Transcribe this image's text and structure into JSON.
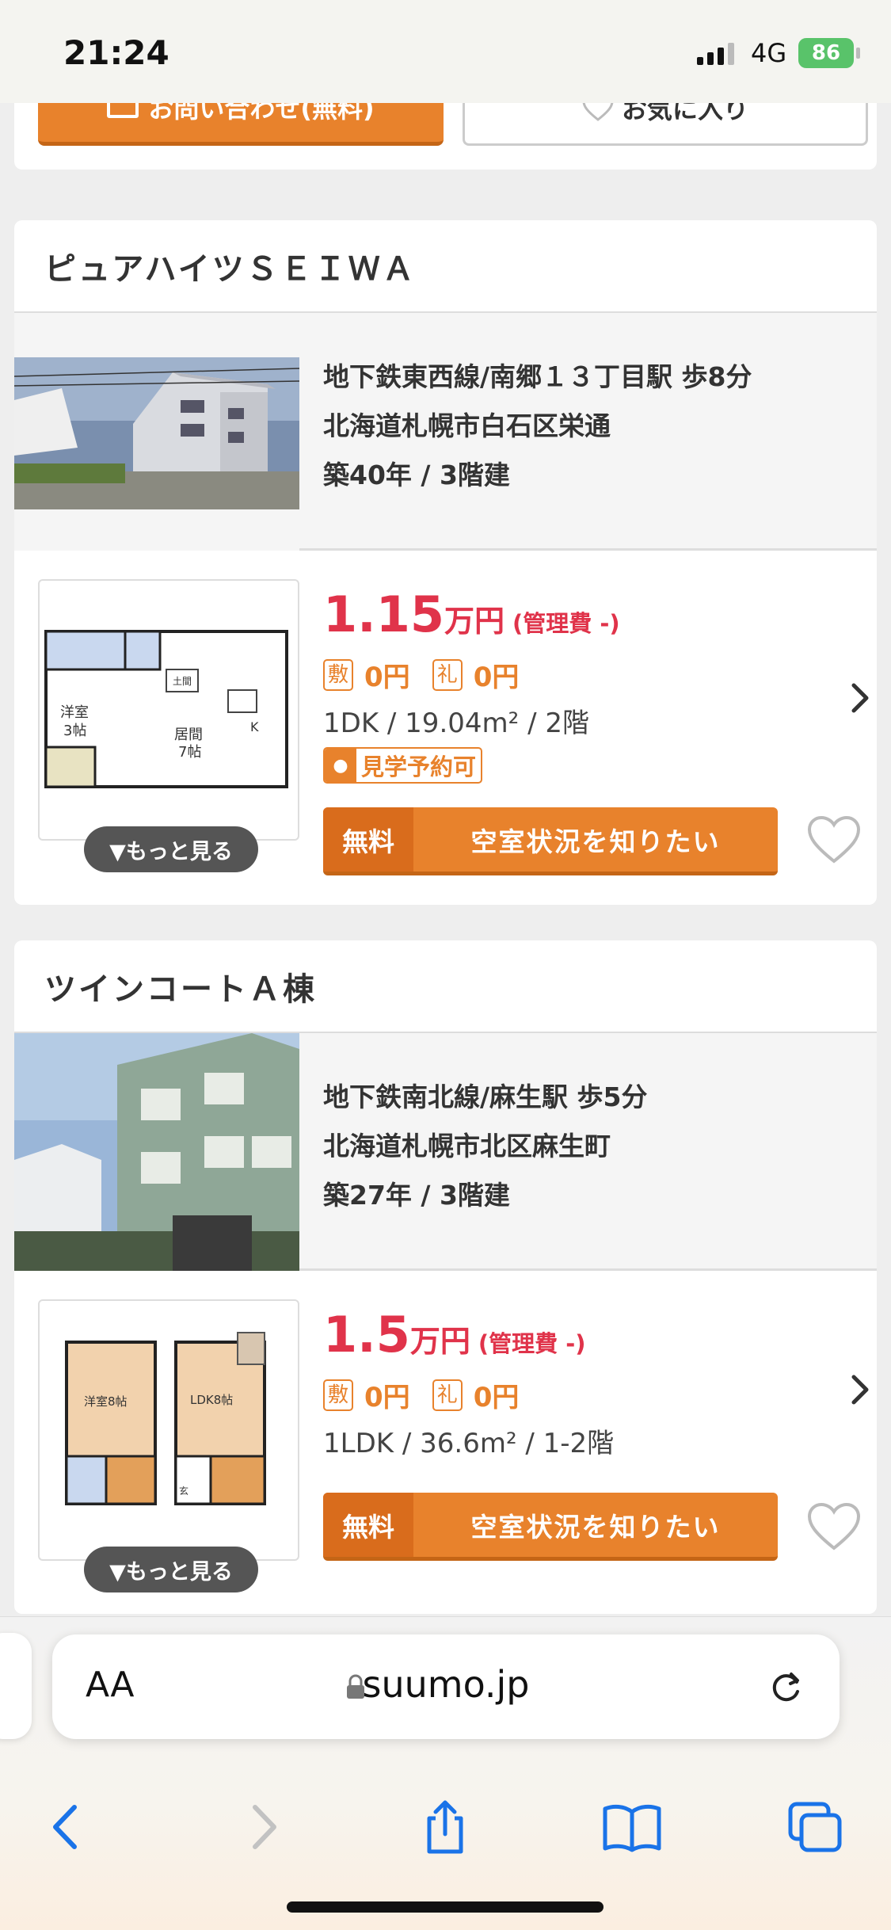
{
  "status_bar": {
    "time": "21:24",
    "network": "4G",
    "battery": "86"
  },
  "top_card": {
    "inquiry_label": "お問い合わせ(無料)",
    "favorite_label": "お気に入り"
  },
  "listings": [
    {
      "name": "ピュアハイツＳＥＩＷＡ",
      "access": "地下鉄東西線/南郷１３丁目駅 歩8分",
      "address": "北海道札幌市白石区栄通",
      "age": "築40年 / 3階建",
      "rent_value": "1.15",
      "rent_unit": "万円",
      "management_fee": "(管理費 -)",
      "deposit_tag": "敷",
      "deposit": "0円",
      "key_money_tag": "礼",
      "key_money": "0円",
      "spec": "1DK /  19.04m² /  2階",
      "visit_badge": "見学予約可",
      "more_label": "▼もっと見る",
      "vacancy_free": "無料",
      "vacancy_label": "空室状況を知りたい",
      "floorplan_labels": {
        "room1": "洋室",
        "room1_size": "3帖",
        "room2": "居間",
        "room2_size": "7帖",
        "k": "K",
        "entry": "土間"
      }
    },
    {
      "name": "ツインコートＡ棟",
      "access": "地下鉄南北線/麻生駅 歩5分",
      "address": "北海道札幌市北区麻生町",
      "age": "築27年 / 3階建",
      "rent_value": "1.5",
      "rent_unit": "万円",
      "management_fee": "(管理費 -)",
      "deposit_tag": "敷",
      "deposit": "0円",
      "key_money_tag": "礼",
      "key_money": "0円",
      "spec": "1LDK /  36.6m² /  1-2階",
      "more_label": "▼もっと見る",
      "vacancy_free": "無料",
      "vacancy_label": "空室状況を知りたい",
      "floorplan_labels": {
        "room1": "洋室8帖",
        "room2": "LDK8帖",
        "entry": "玄"
      }
    }
  ],
  "browser": {
    "aa_label": "AA",
    "domain": "suumo.jp"
  },
  "colors": {
    "accent_orange": "#e8822c",
    "price_red": "#e0334a",
    "ios_blue": "#1a73e8"
  },
  "icons": [
    "mail-icon",
    "heart-icon",
    "chevron-right-icon",
    "lock-icon",
    "reload-icon",
    "back-icon",
    "forward-icon",
    "share-icon",
    "bookmarks-icon",
    "tabs-icon"
  ]
}
